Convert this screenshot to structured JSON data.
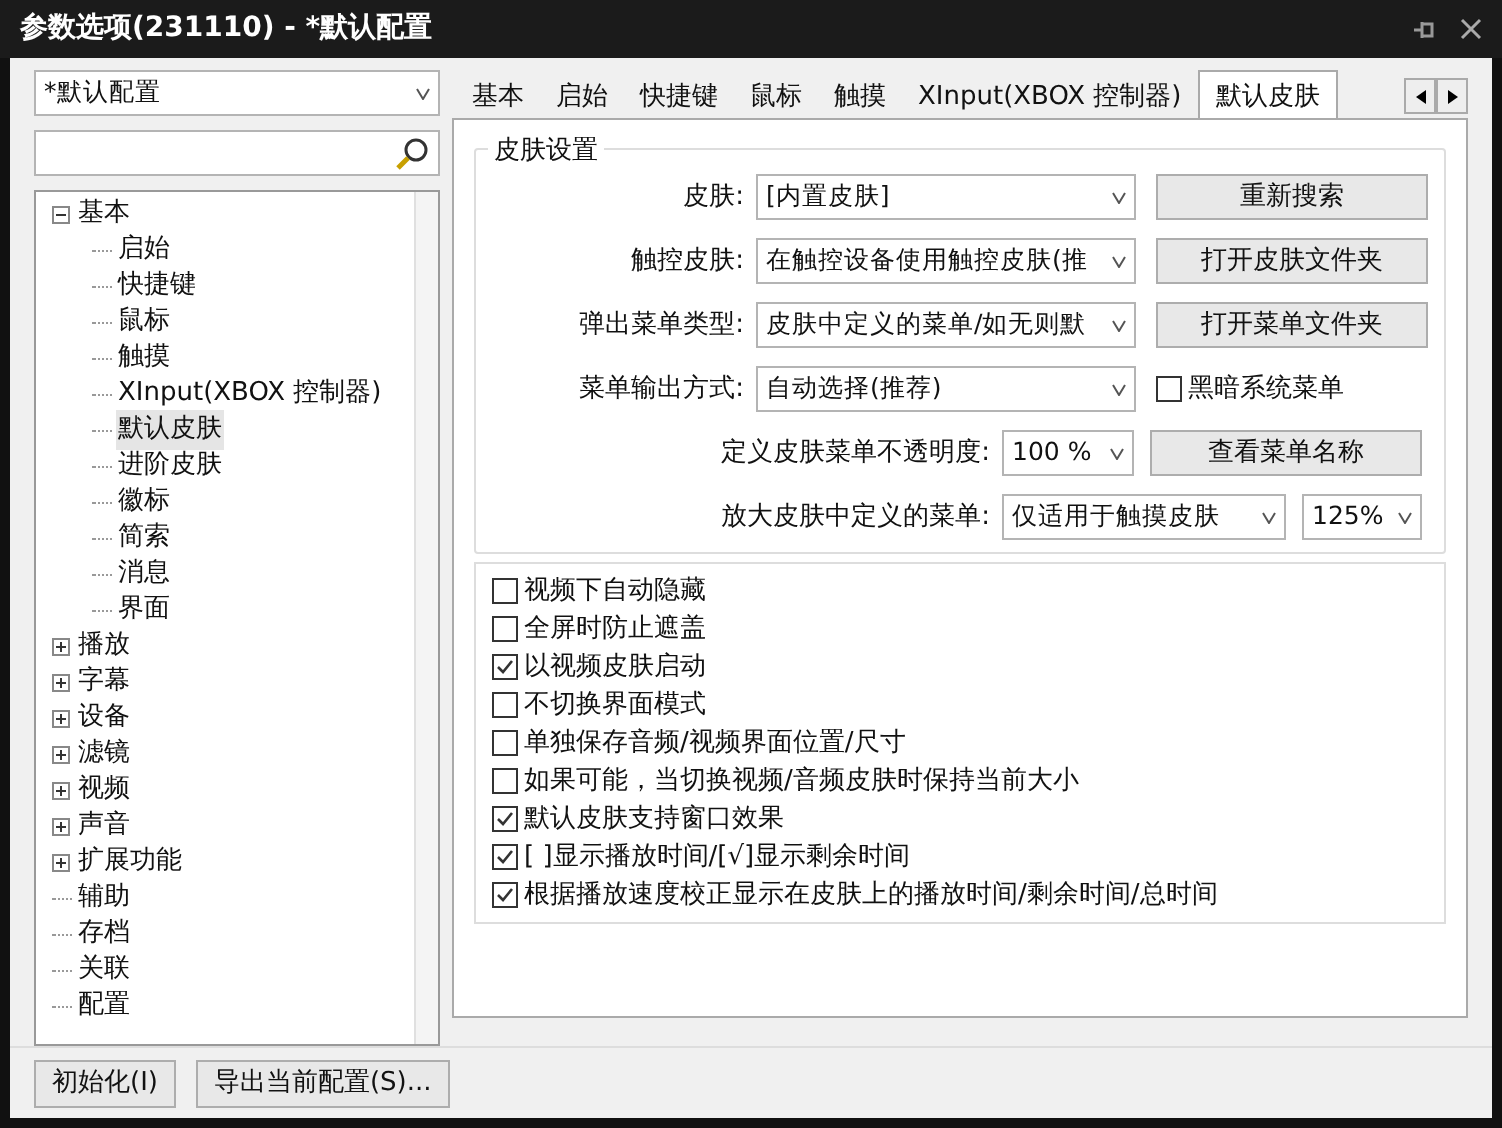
{
  "window": {
    "title": "参数选项(231110) - *默认配置"
  },
  "profile_select": {
    "value": "*默认配置"
  },
  "tree": [
    {
      "label": "基本",
      "expanded": true,
      "selected": false,
      "children": [
        {
          "label": "启始",
          "selected": false
        },
        {
          "label": "快捷键",
          "selected": false
        },
        {
          "label": "鼠标",
          "selected": false
        },
        {
          "label": "触摸",
          "selected": false
        },
        {
          "label": "XInput(XBOX 控制器)",
          "selected": false
        },
        {
          "label": "默认皮肤",
          "selected": true
        },
        {
          "label": "进阶皮肤",
          "selected": false
        },
        {
          "label": "徽标",
          "selected": false
        },
        {
          "label": "简索",
          "selected": false
        },
        {
          "label": "消息",
          "selected": false
        },
        {
          "label": "界面",
          "selected": false
        }
      ]
    },
    {
      "label": "播放",
      "expanded": false,
      "selected": false
    },
    {
      "label": "字幕",
      "expanded": false,
      "selected": false
    },
    {
      "label": "设备",
      "expanded": false,
      "selected": false
    },
    {
      "label": "滤镜",
      "expanded": false,
      "selected": false
    },
    {
      "label": "视频",
      "expanded": false,
      "selected": false
    },
    {
      "label": "声音",
      "expanded": false,
      "selected": false
    },
    {
      "label": "扩展功能",
      "expanded": false,
      "selected": false
    },
    {
      "label": "辅助",
      "selected": false
    },
    {
      "label": "存档",
      "selected": false
    },
    {
      "label": "关联",
      "selected": false
    },
    {
      "label": "配置",
      "selected": false
    }
  ],
  "tabs": [
    {
      "label": "基本",
      "selected": false
    },
    {
      "label": "启始",
      "selected": false
    },
    {
      "label": "快捷键",
      "selected": false
    },
    {
      "label": "鼠标",
      "selected": false
    },
    {
      "label": "触摸",
      "selected": false
    },
    {
      "label": "XInput(XBOX 控制器)",
      "selected": false
    },
    {
      "label": "默认皮肤",
      "selected": true
    }
  ],
  "group": {
    "title": "皮肤设置",
    "rows": [
      {
        "kind": "wide",
        "label": "皮肤:",
        "value": "[内置皮肤]",
        "button": "重新搜索"
      },
      {
        "kind": "wide",
        "label": "触控皮肤:",
        "value": "在触控设备使用触控皮肤(推",
        "button": "打开皮肤文件夹"
      },
      {
        "kind": "wide",
        "label": "弹出菜单类型:",
        "value": "皮肤中定义的菜单/如无则默",
        "button": "打开菜单文件夹"
      },
      {
        "kind": "check",
        "label": "菜单输出方式:",
        "value": "自动选择(推荐)",
        "check_label": "黑暗系统菜单",
        "checked": false
      },
      {
        "kind": "narrow",
        "label": "定义皮肤菜单不透明度:",
        "value": "100 %",
        "button": "查看菜单名称"
      },
      {
        "kind": "pair",
        "label": "放大皮肤中定义的菜单:",
        "value": "仅适用于触摸皮肤",
        "value2": "125%"
      }
    ]
  },
  "options": [
    {
      "label": "视频下自动隐藏",
      "checked": false
    },
    {
      "label": "全屏时防止遮盖",
      "checked": false
    },
    {
      "label": "以视频皮肤启动",
      "checked": true
    },
    {
      "label": "不切换界面模式",
      "checked": false
    },
    {
      "label": "单独保存音频/视频界面位置/尺寸",
      "checked": false
    },
    {
      "label": "如果可能，当切换视频/音频皮肤时保持当前大小",
      "checked": false
    },
    {
      "label": "默认皮肤支持窗口效果",
      "checked": true
    },
    {
      "label": "[ ]显示播放时间/[√]显示剩余时间",
      "checked": true
    },
    {
      "label": "根据播放速度校正显示在皮肤上的播放时间/剩余时间/总时间",
      "checked": true
    }
  ],
  "footer_buttons": [
    "初始化(I)",
    "导出当前配置(S)..."
  ]
}
